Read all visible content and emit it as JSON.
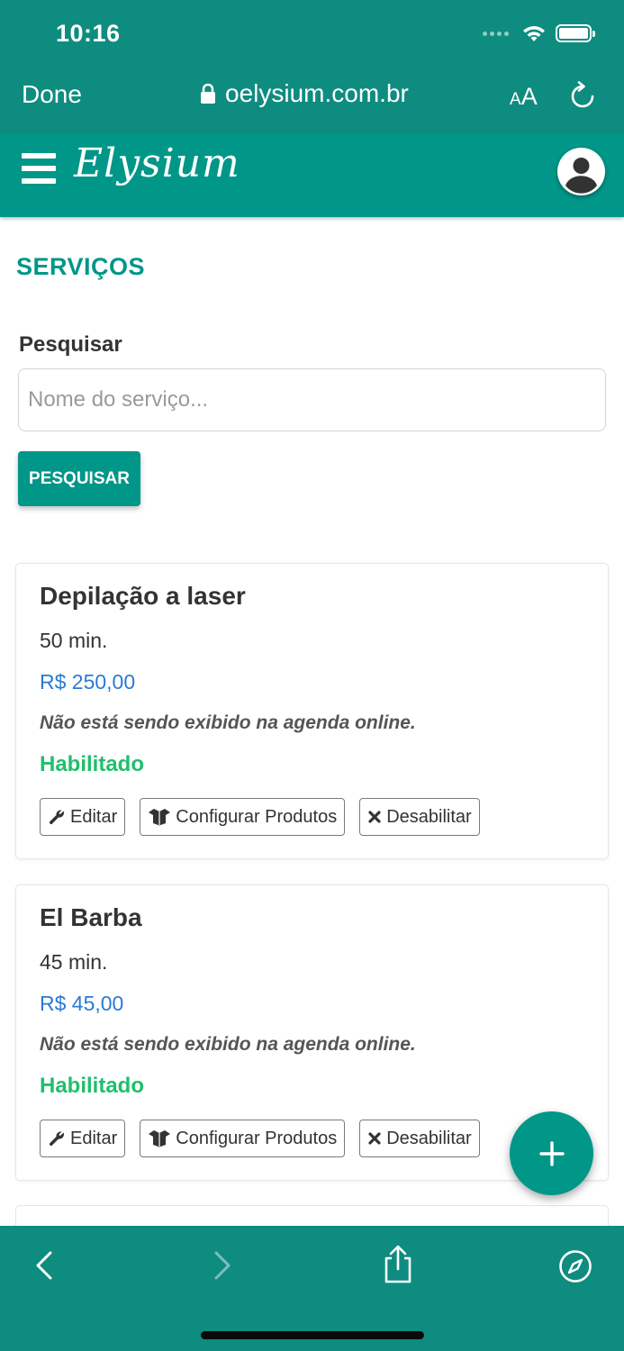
{
  "status_bar": {
    "time": "10:16"
  },
  "browser": {
    "done_label": "Done",
    "url": "oelysium.com.br",
    "aa_small": "A",
    "aa_large": "A"
  },
  "app": {
    "logo_text": "Elysium"
  },
  "page": {
    "title": "SERVIÇOS",
    "search_label": "Pesquisar",
    "search_placeholder": "Nome do serviço...",
    "search_value": "",
    "search_button": "PESQUISAR"
  },
  "services": [
    {
      "name": "Depilação a laser",
      "duration": "50 min.",
      "price": "R$ 250,00",
      "note": "Não está sendo exibido na agenda online.",
      "status": "Habilitado",
      "edit_label": "Editar",
      "products_label": "Configurar Produtos",
      "disable_label": "Desabilitar"
    },
    {
      "name": "El Barba",
      "duration": "45 min.",
      "price": "R$ 45,00",
      "note": "Não está sendo exibido na agenda online.",
      "status": "Habilitado",
      "edit_label": "Editar",
      "products_label": "Configurar Produtos",
      "disable_label": "Desabilitar"
    }
  ],
  "colors": {
    "primary": "#009688",
    "browser_chrome": "#0f8c80",
    "price": "#2a7ad6",
    "status_enabled": "#1fbf6c"
  },
  "icons": {
    "lock": "lock-icon",
    "reload": "reload-icon",
    "menu": "hamburger-menu-icon",
    "user": "user-avatar-icon",
    "edit": "wrench-icon",
    "products": "box-icon",
    "disable": "x-icon",
    "add": "plus-icon",
    "back": "chevron-left-icon",
    "forward": "chevron-right-icon",
    "share": "share-icon",
    "safari": "compass-icon"
  }
}
